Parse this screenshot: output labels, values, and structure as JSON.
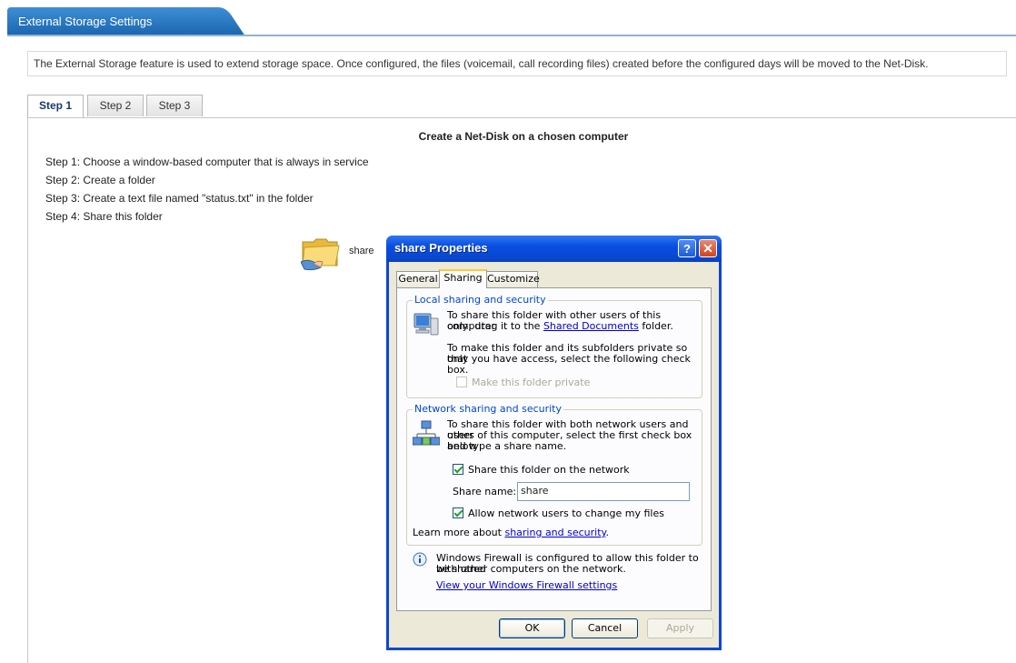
{
  "page_title": "External Storage Settings",
  "notice": "The External Storage feature is used to extend storage space. Once configured, the files (voicemail, call recording files) created before the configured days will be moved to the Net-Disk.",
  "tabs": [
    {
      "label": "Step 1",
      "active": true
    },
    {
      "label": "Step 2",
      "active": false
    },
    {
      "label": "Step 3",
      "active": false
    }
  ],
  "content": {
    "heading": "Create a Net-Disk on a chosen computer",
    "steps": [
      "Step 1: Choose a window-based computer that is always in service",
      "Step 2: Create a folder",
      "Step 3: Create a text file named \"status.txt\" in the folder",
      "Step 4: Share this folder"
    ],
    "folder_label": "share"
  },
  "dialog": {
    "title": "share Properties",
    "help_label": "?",
    "close_label": "✕",
    "tabs": [
      "General",
      "Sharing",
      "Customize"
    ],
    "active_tab": "Sharing",
    "local": {
      "label": "Local sharing and security",
      "text1_a": "To share this folder with other users of this computer",
      "text1_b": "only, drag it to the",
      "link": "Shared Documents",
      "text1_c": "folder.",
      "text2_a": "To make this folder and its subfolders private so that",
      "text2_b": "only you have access, select the following check box.",
      "private_label": "Make this folder private",
      "private_checked": false
    },
    "network": {
      "label": "Network sharing and security",
      "text_a": "To share this folder with both network users and other",
      "text_b": "users of this computer, select the first check box below",
      "text_c": "and type a share name.",
      "share_label": "Share this folder on the network",
      "share_checked": true,
      "share_name_label": "Share name:",
      "share_name_value": "share",
      "allow_label": "Allow network users to change my files",
      "allow_checked": true,
      "learn_prefix": "Learn more about",
      "learn_link": "sharing and security",
      "learn_suffix": "."
    },
    "firewall": {
      "text_a": "Windows Firewall is configured to allow this folder to be shared",
      "text_b": "with other computers on the network.",
      "link": "View your Windows Firewall settings"
    },
    "buttons": {
      "ok": "OK",
      "cancel": "Cancel",
      "apply": "Apply"
    }
  },
  "colors": {
    "title_tab": "#1f6fb8",
    "xp_title": "#0a4ee0",
    "link": "#0000cc",
    "group_label": "#0046d5"
  }
}
